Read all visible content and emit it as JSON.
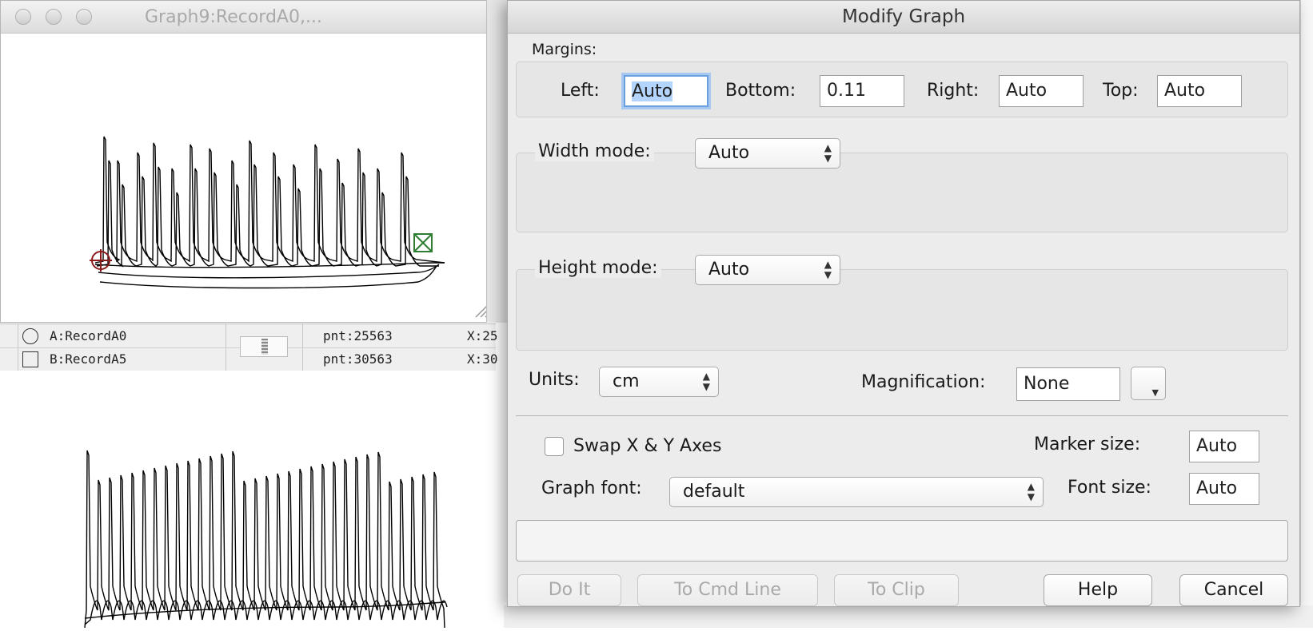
{
  "graph_window": {
    "title": "Graph9:RecordA0,..."
  },
  "cursor_info": {
    "rows": [
      {
        "symbol": "circle",
        "label": "A:RecordA0",
        "pnt": "pnt:25563",
        "x": "X:25"
      },
      {
        "symbol": "square",
        "label": "B:RecordA5",
        "pnt": "pnt:30563",
        "x": "X:30"
      }
    ]
  },
  "dialog": {
    "title": "Modify Graph",
    "margins": {
      "section_label": "Margins:",
      "left_label": "Left:",
      "left_value": "Auto",
      "bottom_label": "Bottom:",
      "bottom_value": "0.11",
      "right_label": "Right:",
      "right_value": "Auto",
      "top_label": "Top:",
      "top_value": "Auto"
    },
    "width_mode": {
      "label": "Width mode:",
      "value": "Auto"
    },
    "height_mode": {
      "label": "Height mode:",
      "value": "Auto"
    },
    "units": {
      "label": "Units:",
      "value": "cm"
    },
    "magnification": {
      "label": "Magnification:",
      "value": "None"
    },
    "swap_axes": {
      "label": "Swap X & Y Axes",
      "checked": false
    },
    "marker_size": {
      "label": "Marker size:",
      "value": "Auto"
    },
    "graph_font": {
      "label": "Graph font:",
      "value": "default"
    },
    "font_size": {
      "label": "Font size:",
      "value": "Auto"
    },
    "command_line": "",
    "buttons": {
      "do_it": "Do It",
      "to_cmd_line": "To Cmd Line",
      "to_clip": "To Clip",
      "help": "Help",
      "cancel": "Cancel"
    }
  }
}
